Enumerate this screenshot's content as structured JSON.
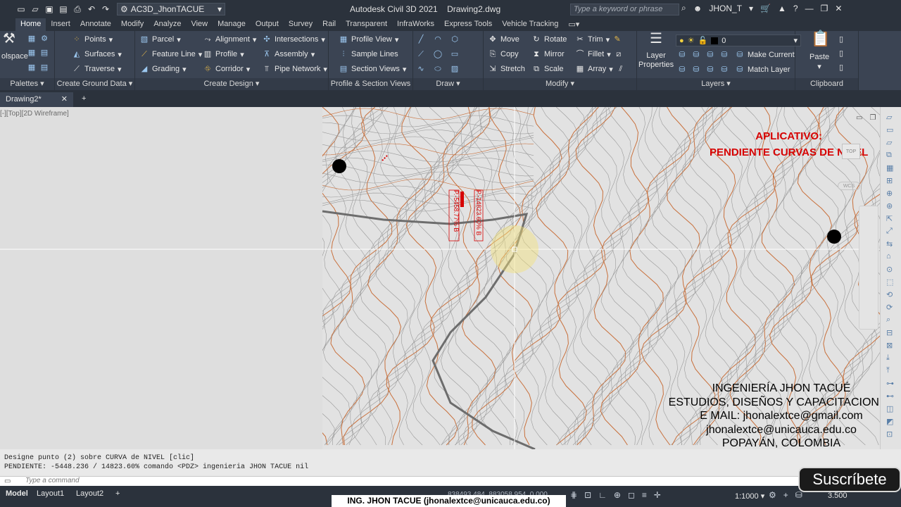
{
  "titlebar": {
    "workspace": "AC3D_JhonTACUE",
    "app_title": "Autodesk Civil 3D 2021",
    "drawing_name": "Drawing2.dwg",
    "search_placeholder": "Type a keyword or phrase",
    "user": "JHON_T"
  },
  "tabs": [
    "Home",
    "Insert",
    "Annotate",
    "Modify",
    "Analyze",
    "View",
    "Manage",
    "Output",
    "Survey",
    "Rail",
    "Transparent",
    "InfraWorks",
    "Express Tools",
    "Vehicle Tracking"
  ],
  "active_tab": "Home",
  "ribbon": {
    "toolspace": "olspace",
    "palettes": "Palettes",
    "ground": {
      "points": "Points",
      "surfaces": "Surfaces",
      "traverse": "Traverse",
      "title": "Create Ground Data"
    },
    "design": {
      "parcel": "Parcel",
      "feature_line": "Feature Line",
      "grading": "Grading",
      "alignment": "Alignment",
      "profile": "Profile",
      "corridor": "Corridor",
      "intersections": "Intersections",
      "assembly": "Assembly",
      "pipe_network": "Pipe Network",
      "title": "Create Design"
    },
    "profile": {
      "profile_view": "Profile View",
      "sample_lines": "Sample Lines",
      "section_views": "Section Views",
      "title": "Profile & Section Views"
    },
    "draw_title": "Draw",
    "modify": {
      "move": "Move",
      "rotate": "Rotate",
      "trim": "Trim",
      "copy": "Copy",
      "mirror": "Mirror",
      "fillet": "Fillet",
      "stretch": "Stretch",
      "scale": "Scale",
      "array": "Array",
      "title": "Modify"
    },
    "layers": {
      "layer_properties_1": "Layer",
      "layer_properties_2": "Properties",
      "current_layer": "0",
      "make_current": "Make Current",
      "match_layer": "Match Layer",
      "title": "Layers"
    },
    "clipboard": {
      "paste": "Paste",
      "title": "Clipboard"
    }
  },
  "doc_tab": "Drawing2*",
  "viewport_label": "[-][Top][2D Wireframe]",
  "viewcube": {
    "top": "TOP",
    "wcs": "WCS"
  },
  "labels_on_map": {
    "label_a": "P.-5458.77% B",
    "label_b": "P.-14823.60% B"
  },
  "overlay": {
    "title_line1": "APLICATIVO:",
    "title_line2": "PENDIENTE CURVAS DE NIVEL",
    "credits": [
      "INGENIERÍA JHON TACUÉ",
      "ESTUDIOS, DISEÑOS Y CAPACITACIONES",
      "E MAIL: jhonalextce@gmail.com",
      "jhonalextce@unicauca.edu.co",
      "POPAYÁN, COLOMBIA"
    ],
    "subscribe": "Suscríbete",
    "banner": "ING. JHON TACUE (jhonalextce@unicauca.edu.co)"
  },
  "command": {
    "line1": "Designe punto (2) sobre CURVA de NIVEL [clic]",
    "line2": "  PENDIENTE: -5448.236 / 14823.60%  comando <PDZ> ingenieria JHON TACUE  nil",
    "input_placeholder": "Type a command"
  },
  "status": {
    "model": "Model",
    "layout1": "Layout1",
    "layout2": "Layout2",
    "coords": "838493.484, 883058.954, 0.000",
    "scale": "1:1000",
    "value": "3.500"
  },
  "colors": {
    "contour": "#c8703c",
    "contour_minor": "#9a9a9a",
    "road": "#6d6d6d",
    "accent_red": "#d60000"
  }
}
